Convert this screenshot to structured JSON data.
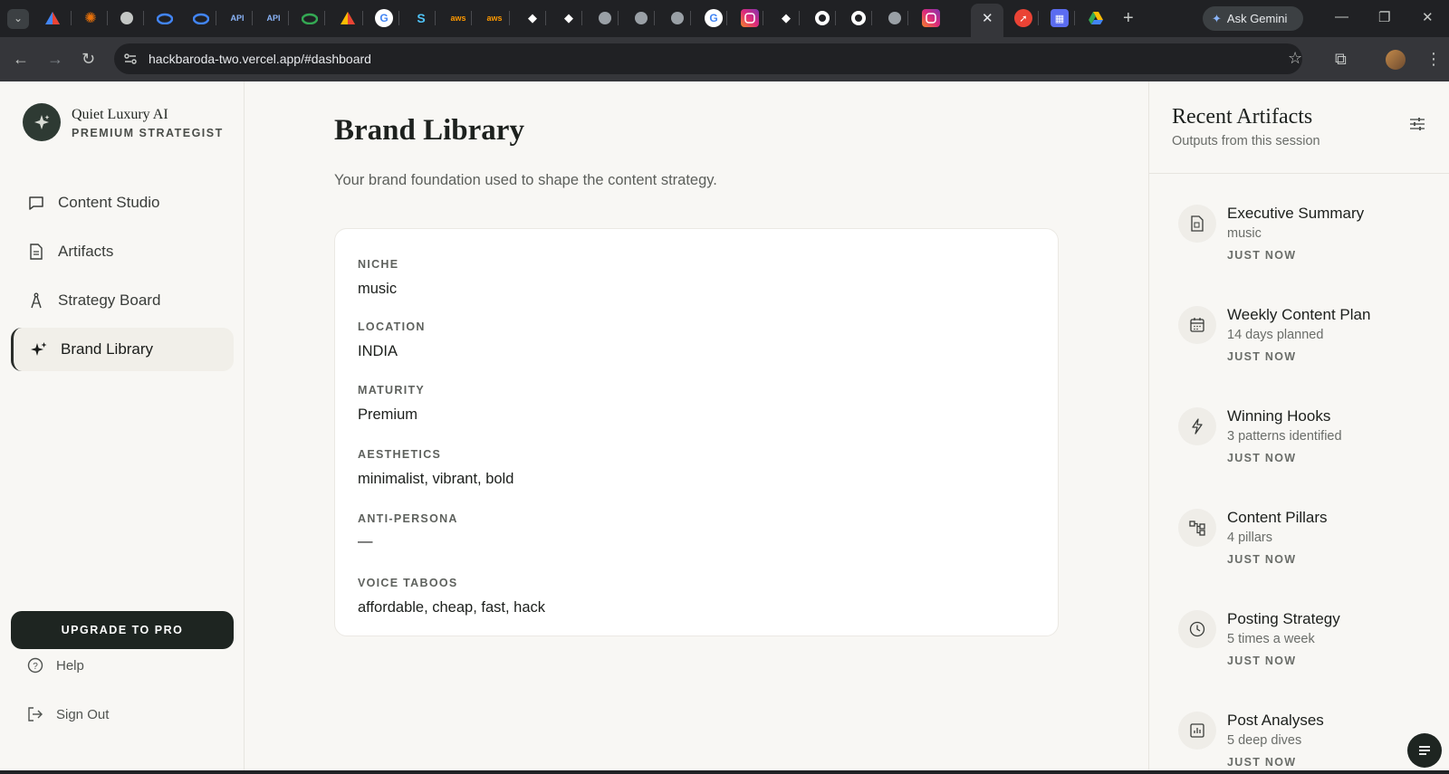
{
  "browser": {
    "url": "hackbaroda-two.vercel.app/#dashboard",
    "ask_gemini": "Ask Gemini",
    "tab_labels": [
      "API",
      "API"
    ]
  },
  "app": {
    "brand_name": "Quiet Luxury AI",
    "brand_sub": "PREMIUM STRATEGIST",
    "nav": [
      {
        "label": "Content Studio",
        "icon": "chat-bubble-icon"
      },
      {
        "label": "Artifacts",
        "icon": "document-icon"
      },
      {
        "label": "Strategy Board",
        "icon": "compass-icon"
      },
      {
        "label": "Brand Library",
        "icon": "sparkles-icon",
        "active": true
      }
    ],
    "upgrade_label": "UPGRADE TO PRO",
    "help_label": "Help",
    "signout_label": "Sign Out"
  },
  "main": {
    "title": "Brand Library",
    "description": "Your brand foundation used to shape the content strategy.",
    "fields": [
      {
        "label": "NICHE",
        "value": "music"
      },
      {
        "label": "LOCATION",
        "value": "INDIA"
      },
      {
        "label": "MATURITY",
        "value": "Premium"
      },
      {
        "label": "AESTHETICS",
        "value": "minimalist, vibrant, bold"
      },
      {
        "label": "ANTI-PERSONA",
        "value": "—"
      },
      {
        "label": "VOICE TABOOS",
        "value": "affordable, cheap, fast, hack"
      }
    ]
  },
  "artifacts": {
    "title": "Recent Artifacts",
    "subtitle": "Outputs from this session",
    "items": [
      {
        "title": "Executive Summary",
        "sub": "music",
        "time": "JUST NOW",
        "icon": "summary-icon"
      },
      {
        "title": "Weekly Content Plan",
        "sub": "14 days planned",
        "time": "JUST NOW",
        "icon": "calendar-icon"
      },
      {
        "title": "Winning Hooks",
        "sub": "3 patterns identified",
        "time": "JUST NOW",
        "icon": "lightning-icon"
      },
      {
        "title": "Content Pillars",
        "sub": "4 pillars",
        "time": "JUST NOW",
        "icon": "hierarchy-icon"
      },
      {
        "title": "Posting Strategy",
        "sub": "5 times a week",
        "time": "JUST NOW",
        "icon": "clock-icon"
      },
      {
        "title": "Post Analyses",
        "sub": "5 deep dives",
        "time": "JUST NOW",
        "icon": "bar-chart-icon"
      }
    ]
  }
}
